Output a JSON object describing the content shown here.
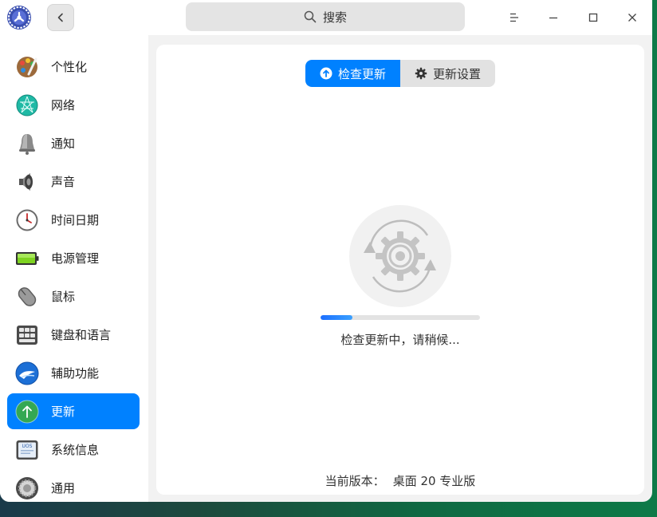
{
  "search": {
    "label": "搜索"
  },
  "sidebar": {
    "items": [
      {
        "label": "个性化",
        "icon": "personalization-icon"
      },
      {
        "label": "网络",
        "icon": "network-icon"
      },
      {
        "label": "通知",
        "icon": "bell-icon"
      },
      {
        "label": "声音",
        "icon": "speaker-icon"
      },
      {
        "label": "时间日期",
        "icon": "clock-icon"
      },
      {
        "label": "电源管理",
        "icon": "battery-icon"
      },
      {
        "label": "鼠标",
        "icon": "mouse-icon"
      },
      {
        "label": "键盘和语言",
        "icon": "keyboard-icon"
      },
      {
        "label": "辅助功能",
        "icon": "accessibility-icon"
      },
      {
        "label": "更新",
        "icon": "update-arrow-icon",
        "active": true
      },
      {
        "label": "系统信息",
        "icon": "system-info-icon",
        "badge": "UOS"
      },
      {
        "label": "通用",
        "icon": "general-settings-icon"
      }
    ]
  },
  "tabs": {
    "check_label": "检查更新",
    "settings_label": "更新设置"
  },
  "status": {
    "progress": 0.2,
    "text": "检查更新中，请稍候..."
  },
  "version": {
    "label": "当前版本：",
    "value": "桌面 20 专业版"
  },
  "colors": {
    "accent": "#0081ff",
    "window_bg": "#f2f2f2"
  }
}
